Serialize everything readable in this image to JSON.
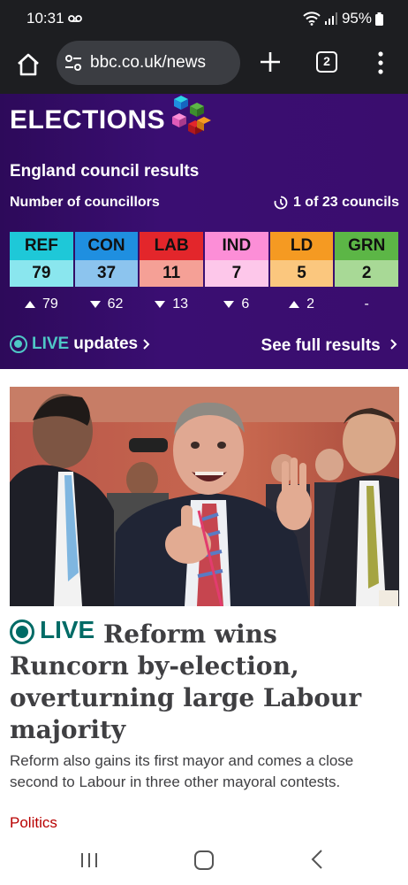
{
  "status_bar": {
    "time": "10:31",
    "battery": "95%",
    "icons": [
      "voicemail-icon",
      "wifi-icon",
      "signal-icon",
      "battery-icon"
    ]
  },
  "browser": {
    "url": "bbc.co.uk/news",
    "tab_count": "2",
    "icons": [
      "home-icon",
      "tune-icon",
      "plus-icon",
      "tabs-icon",
      "menu-dots-icon"
    ]
  },
  "elections": {
    "title": "ELECTIONS",
    "heading": "England council results",
    "councillors_label": "Number of councillors",
    "councils_count": "1 of 23 councils",
    "parties": [
      {
        "name": "REF",
        "seats": "79",
        "change": "79",
        "direction": "up",
        "header_color": "#1ec8d8",
        "body_color": "#8ae6ee"
      },
      {
        "name": "CON",
        "seats": "37",
        "change": "62",
        "direction": "down",
        "header_color": "#1f8fe0",
        "body_color": "#8cc4ee"
      },
      {
        "name": "LAB",
        "seats": "11",
        "change": "13",
        "direction": "down",
        "header_color": "#e3262b",
        "body_color": "#f5a096"
      },
      {
        "name": "IND",
        "seats": "7",
        "change": "6",
        "direction": "down",
        "header_color": "#fc8ed7",
        "body_color": "#fdc7ea"
      },
      {
        "name": "LD",
        "seats": "5",
        "change": "2",
        "direction": "up",
        "header_color": "#f59a22",
        "body_color": "#fbc77e"
      },
      {
        "name": "GRN",
        "seats": "2",
        "change": "-",
        "direction": "none",
        "header_color": "#5cb646",
        "body_color": "#a8d996"
      }
    ],
    "live_label": "LIVE",
    "live_suffix": "updates",
    "see_full_results": "See full results"
  },
  "article": {
    "live_label": "LIVE",
    "headline": "Reform wins Runcorn by-election, overturning large Labour majority",
    "summary": "Reform also gains its first mayor and comes a close second to Labour in three other mayoral contests.",
    "tag": "Politics"
  }
}
